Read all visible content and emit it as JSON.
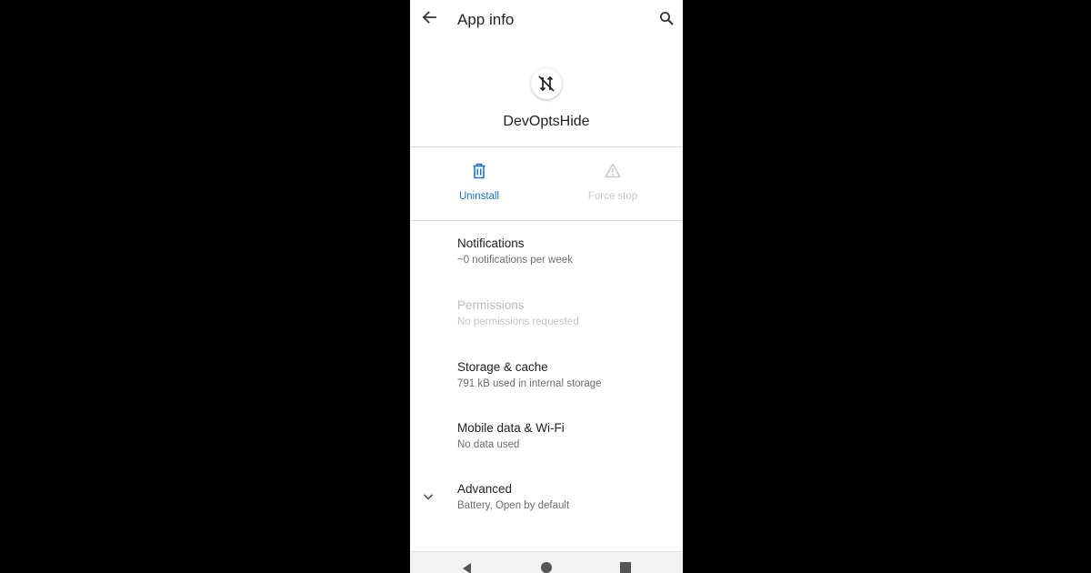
{
  "appbar": {
    "title": "App info",
    "back_icon": "arrow-back-icon",
    "search_icon": "search-icon"
  },
  "app": {
    "name": "DevOptsHide",
    "icon": "devoptshide-app-icon"
  },
  "actions": {
    "uninstall": {
      "label": "Uninstall",
      "icon": "trash-icon",
      "color": "#1a73c8",
      "enabled": true
    },
    "force_stop": {
      "label": "Force stop",
      "icon": "warning-icon",
      "color": "#c8c8c8",
      "enabled": false
    }
  },
  "items": [
    {
      "title": "Notifications",
      "subtitle": "~0 notifications per week",
      "enabled": true
    },
    {
      "title": "Permissions",
      "subtitle": "No permissions requested",
      "enabled": false
    },
    {
      "title": "Storage & cache",
      "subtitle": "791 kB used in internal storage",
      "enabled": true
    },
    {
      "title": "Mobile data & Wi-Fi",
      "subtitle": "No data used",
      "enabled": true
    },
    {
      "title": "Advanced",
      "subtitle": "Battery, Open by default",
      "enabled": true,
      "icon": "chevron-down-icon"
    }
  ],
  "navbar": {
    "back_icon": "nav-back-icon",
    "home_icon": "nav-home-icon",
    "recents_icon": "nav-recents-icon"
  }
}
